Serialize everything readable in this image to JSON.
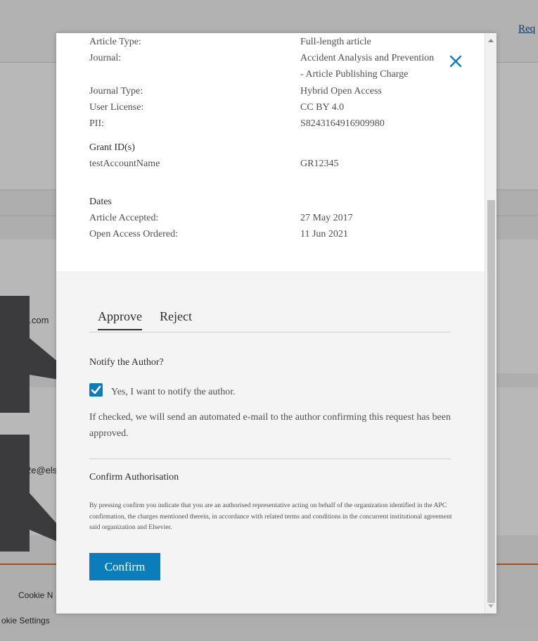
{
  "background": {
    "top_right_link": "Req",
    "left_fragment_email_1": "e.com",
    "left_fragment_email_2": "2e@els",
    "footer_cookie_notice": "Cookie N",
    "footer_cookie_settings": "okie Settings"
  },
  "modal": {
    "fields": [
      {
        "label": "Article Type:",
        "value": "Full-length article"
      },
      {
        "label": "Journal:",
        "value": "Accident Analysis and Prevention",
        "value_line2": "- Article Publishing Charge"
      },
      {
        "label": "Journal Type:",
        "value": "Hybrid Open Access"
      },
      {
        "label": "User License:",
        "value": "CC BY 4.0"
      },
      {
        "label": "PII:",
        "value": "S8243164916909980"
      }
    ],
    "grant": {
      "heading": "Grant ID(s)",
      "name": "testAccountName",
      "id": "GR12345"
    },
    "dates": {
      "heading": "Dates",
      "accepted_label": "Article Accepted:",
      "accepted_value": "27 May 2017",
      "ordered_label": "Open Access Ordered:",
      "ordered_value": "11 Jun 2021"
    },
    "tabs": [
      {
        "label": "Approve",
        "active": true
      },
      {
        "label": "Reject",
        "active": false
      }
    ],
    "notify": {
      "heading": "Notify the Author?",
      "checkbox_label": "Yes, I want to notify the author.",
      "checked": true,
      "info": "If checked, we will send an automated e-mail to the author confirming this request has been approved."
    },
    "confirm": {
      "heading": "Confirm Authorisation",
      "disclaimer": "By pressing confirm you indicate that you are an authorised representative acting on behalf of the organization identified in the APC confirmation, the charges mentioned therein, in accordance with related terms and conditions in the concurrent institutional agreement said organization and Elsevier.",
      "button_label": "Confirm"
    }
  },
  "colors": {
    "accent": "#0c7dbb",
    "close_icon": "#0c7dbb",
    "callout": "#3b3b3d",
    "footer_rule": "#e9711c"
  },
  "icons": {
    "close": "close-icon",
    "check": "check-icon"
  }
}
